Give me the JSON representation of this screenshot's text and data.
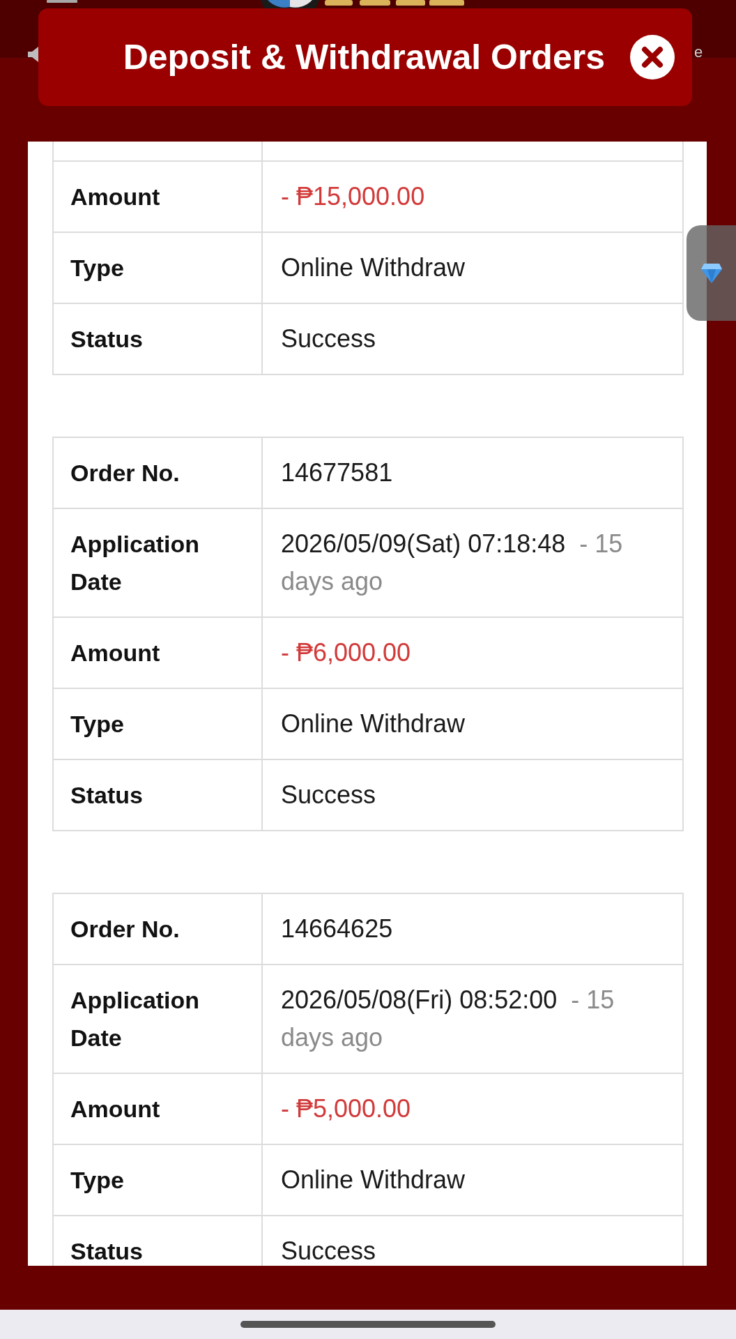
{
  "background": {
    "marquee_text": "e"
  },
  "modal": {
    "title": "Deposit & Withdrawal Orders"
  },
  "orders": [
    {
      "fields": [
        {
          "kind": "amount",
          "label": "Amount",
          "value": "- ₱15,000.00"
        },
        {
          "kind": "text",
          "label": "Type",
          "value": "Online Withdraw"
        },
        {
          "kind": "text",
          "label": "Status",
          "value": "Success"
        }
      ]
    },
    {
      "fields": [
        {
          "kind": "text",
          "label": "Order No.",
          "value": "14677581"
        },
        {
          "kind": "date",
          "label": "Application Date",
          "value": "2026/05/09(Sat) 07:18:48",
          "ago": "- 15 days ago"
        },
        {
          "kind": "amount",
          "label": "Amount",
          "value": "- ₱6,000.00"
        },
        {
          "kind": "text",
          "label": "Type",
          "value": "Online Withdraw"
        },
        {
          "kind": "text",
          "label": "Status",
          "value": "Success"
        }
      ]
    },
    {
      "fields": [
        {
          "kind": "text",
          "label": "Order No.",
          "value": "14664625"
        },
        {
          "kind": "date",
          "label": "Application Date",
          "value": "2026/05/08(Fri) 08:52:00",
          "ago": "- 15 days ago"
        },
        {
          "kind": "amount",
          "label": "Amount",
          "value": "- ₱5,000.00"
        },
        {
          "kind": "text",
          "label": "Type",
          "value": "Online Withdraw"
        },
        {
          "kind": "text",
          "label": "Status",
          "value": "Success"
        }
      ]
    }
  ]
}
